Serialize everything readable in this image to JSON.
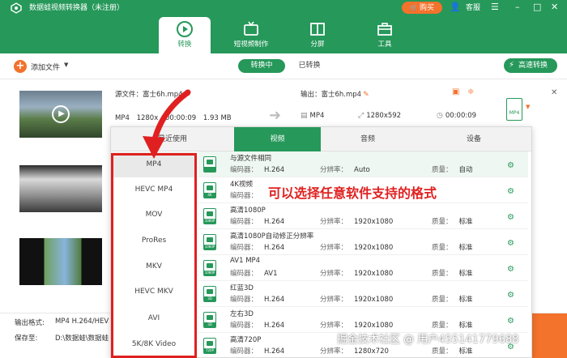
{
  "app": {
    "title": "数据蛙视频转换器（未注册）",
    "buy_label": "购买",
    "service_label": "客服",
    "accent_color": "#26985a",
    "orange_color": "#f3722c"
  },
  "nav_tabs": [
    {
      "label": "转换",
      "icon": "convert-icon",
      "active": true
    },
    {
      "label": "短视频制作",
      "icon": "tv-icon",
      "active": false
    },
    {
      "label": "分屏",
      "icon": "split-screen-icon",
      "active": false
    },
    {
      "label": "工具",
      "icon": "toolbox-icon",
      "active": false
    }
  ],
  "toolbar": {
    "add_file_label": "添加文件",
    "tab_converting": "转换中",
    "tab_converted": "已转换",
    "fast_convert_label": "高速转换"
  },
  "file": {
    "source_label": "源文件：富士6h.mp4",
    "source_format": "MP4",
    "source_resolution": "1280x",
    "source_duration": "00:00:09",
    "source_size": "1.93 MB",
    "output_label": "输出：富士6h.mp4",
    "output_format": "MP4",
    "output_resolution": "1280x592",
    "output_duration": "00:00:09"
  },
  "dropdown": {
    "tabs": [
      {
        "label": "最近使用",
        "active": false
      },
      {
        "label": "视频",
        "active": true
      },
      {
        "label": "音频",
        "active": false
      },
      {
        "label": "设备",
        "active": false
      }
    ],
    "formats": [
      "MP4",
      "HEVC MP4",
      "MOV",
      "ProRes",
      "MKV",
      "HEVC MKV",
      "AVI",
      "5K/8K Video"
    ],
    "selected_format": "MP4",
    "encoder_label": "编码器：",
    "resolution_label": "分辨率：",
    "quality_label": "质量：",
    "presets": [
      {
        "title": "与源文件相同",
        "encoder": "H.264",
        "resolution": "Auto",
        "quality": "自动",
        "badge": ""
      },
      {
        "title": "4K视频",
        "encoder": "",
        "resolution": "",
        "quality": "",
        "badge": "4K"
      },
      {
        "title": "高清1080P",
        "encoder": "H.264",
        "resolution": "1920x1080",
        "quality": "标准",
        "badge": "1080P"
      },
      {
        "title": "高清1080P自动修正分辨率",
        "encoder": "H.264",
        "resolution": "1920x1080",
        "quality": "标准",
        "badge": "1080P"
      },
      {
        "title": "AV1 MP4",
        "encoder": "AV1",
        "resolution": "1920x1080",
        "quality": "标准",
        "badge": "1080P"
      },
      {
        "title": "红蓝3D",
        "encoder": "H.264",
        "resolution": "1920x1080",
        "quality": "标准",
        "badge": "3D"
      },
      {
        "title": "左右3D",
        "encoder": "H.264",
        "resolution": "1920x1080",
        "quality": "标准",
        "badge": "3D"
      },
      {
        "title": "高清720P",
        "encoder": "H.264",
        "resolution": "1280x720",
        "quality": "标准",
        "badge": "720P"
      }
    ]
  },
  "annotation": "可以选择任意软件支持的格式",
  "bottom": {
    "output_format_label": "输出格式:",
    "output_format_value": "MP4 H.264/HEV",
    "save_to_label": "保存至:",
    "save_to_value": "D:\\数据蛙\\数据蛙"
  },
  "watermark": "掘金技术社区 @ 用户455141779688"
}
